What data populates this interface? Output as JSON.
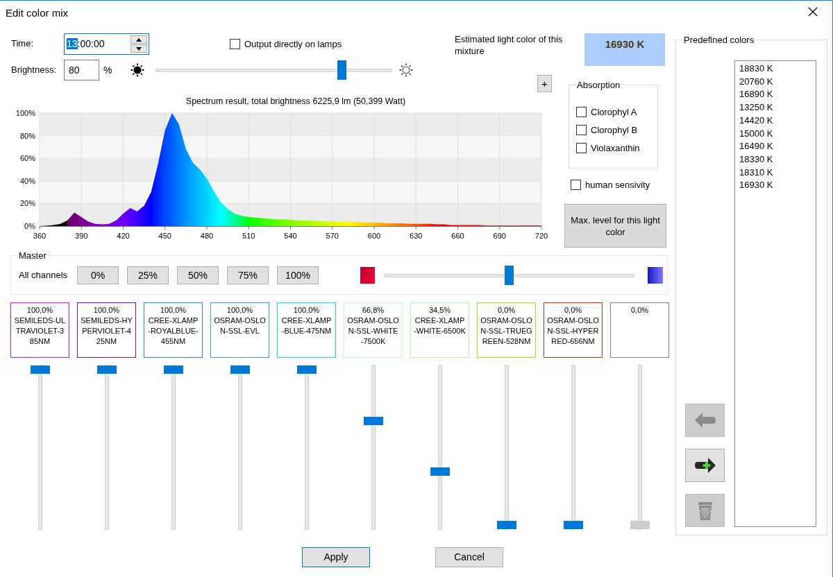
{
  "window": {
    "title": "Edit color mix"
  },
  "time": {
    "label": "Time:",
    "value_parts": [
      {
        "text": "13",
        "selected": true
      },
      {
        "text": ":00:00",
        "selected": false
      }
    ]
  },
  "output_directly": {
    "label": "Output directly on lamps",
    "checked": false
  },
  "brightness": {
    "label": "Brightness:",
    "value": "80",
    "unit": "%",
    "level": 0.8
  },
  "estimate": {
    "label": "Estimated light color of this mixture",
    "value": "16930 K"
  },
  "zoom_button": {
    "label": "+"
  },
  "spectrum": {
    "chart_data": {
      "type": "area",
      "title": "Spectrum result, total brightness 6225,9 lm (50,399 Watt)",
      "x": [
        360,
        365,
        370,
        375,
        380,
        385,
        390,
        395,
        400,
        405,
        410,
        415,
        420,
        425,
        430,
        435,
        440,
        445,
        450,
        455,
        460,
        465,
        470,
        475,
        480,
        485,
        490,
        495,
        500,
        505,
        510,
        515,
        520,
        525,
        530,
        535,
        540,
        545,
        550,
        555,
        560,
        565,
        570,
        575,
        580,
        585,
        590,
        595,
        600,
        605,
        610,
        615,
        620,
        625,
        630,
        635,
        640,
        645,
        650,
        655,
        660,
        665,
        670,
        675,
        680,
        685,
        690,
        695,
        700,
        705,
        710,
        715,
        720
      ],
      "values": [
        0,
        0.3,
        1,
        2,
        5,
        12,
        8,
        4,
        2,
        1.5,
        2,
        5,
        11,
        16,
        13,
        18,
        30,
        55,
        85,
        100,
        90,
        68,
        56,
        50,
        42,
        31,
        21,
        15,
        11,
        9,
        8,
        7.5,
        7,
        6.5,
        6,
        6,
        5.5,
        5,
        5,
        5,
        4.5,
        4.5,
        4,
        4,
        4,
        3.5,
        3.5,
        3,
        3,
        3,
        2.5,
        2.5,
        2.5,
        2,
        2,
        2,
        2,
        1.5,
        1.5,
        1,
        1,
        1,
        1,
        1,
        0.5,
        0.5,
        0.5,
        0.5,
        0.5,
        0.5,
        0.5,
        0.5,
        0.5
      ],
      "xlim": [
        360,
        720
      ],
      "ylim": [
        0,
        100
      ],
      "xticks": [
        360,
        390,
        420,
        450,
        480,
        510,
        540,
        570,
        600,
        630,
        660,
        690,
        720
      ],
      "yticks": [
        {
          "value": 0,
          "label": "0%"
        },
        {
          "value": 20,
          "label": "20%"
        },
        {
          "value": 40,
          "label": "40%"
        },
        {
          "value": 60,
          "label": "60%"
        },
        {
          "value": 80,
          "label": "80%"
        },
        {
          "value": 100,
          "label": "100%"
        }
      ],
      "grid": true
    }
  },
  "absorption": {
    "title": "Absorption",
    "items": [
      {
        "label": "Clorophyl A",
        "checked": false
      },
      {
        "label": "Clorophyl B",
        "checked": false
      },
      {
        "label": "Violaxanthin",
        "checked": false
      }
    ]
  },
  "human_sensitivity": {
    "label": "human sensivity",
    "checked": false
  },
  "max_level_button": {
    "label": "Max. level for this light color"
  },
  "master": {
    "title": "Master",
    "label": "All channels",
    "presets": [
      "0%",
      "25%",
      "50%",
      "75%",
      "100%"
    ],
    "level": 0.5
  },
  "channels": [
    {
      "level_text": "100,0%",
      "name": "SEMILEDS-ULTRAVIOLET-385NM",
      "color": "#ff00ff",
      "level": 1,
      "disabled": false
    },
    {
      "level_text": "100,0%",
      "name": "SEMILEDS-HYPERVIOLET-425NM",
      "color": "#7f00ff",
      "level": 1,
      "disabled": false
    },
    {
      "level_text": "100,0%",
      "name": "CREE-XLAMP-ROYALBLUE-455NM",
      "color": "#1e88ff",
      "level": 1,
      "disabled": false
    },
    {
      "level_text": "100,0%",
      "name": "OSRAM-OSLON-SSL-EVL",
      "color": "#3399ff",
      "level": 1,
      "disabled": false
    },
    {
      "level_text": "100,0%",
      "name": "CREE-XLAMP-BLUE-475NM",
      "color": "#00e1ff",
      "level": 1,
      "disabled": false
    },
    {
      "level_text": "66,8%",
      "name": "OSRAM-OSLON-SSL-WHITE-7500K",
      "color": "#c4ffc4",
      "level": 0.668,
      "disabled": false
    },
    {
      "level_text": "34,5%",
      "name": "CREE-XLAMP-WHITE-6500K",
      "color": "#b0ffb0",
      "level": 0.345,
      "disabled": false
    },
    {
      "level_text": "0,0%",
      "name": "OSRAM-OSLON-SSL-TRUEGREEN-528NM",
      "color": "#80ff00",
      "level": 0,
      "disabled": false
    },
    {
      "level_text": "0,0%",
      "name": "OSRAM-OSLON-SSL-HYPERRED-656NM",
      "color": "#ff2000",
      "level": 0,
      "disabled": false
    },
    {
      "level_text": "0,0%",
      "color": "#808080",
      "level": 0,
      "disabled": true
    }
  ],
  "predefined": {
    "title": "Predefined colors",
    "items": [
      {
        "label": "18830 K",
        "selected": false
      },
      {
        "label": "20760 K",
        "selected": false
      },
      {
        "label": "16890 K",
        "selected": false
      },
      {
        "label": "13250 K",
        "selected": false
      },
      {
        "label": "14420 K",
        "selected": false
      },
      {
        "label": "15000 K",
        "selected": false
      },
      {
        "label": "16490 K",
        "selected": false
      },
      {
        "label": "18330 K",
        "selected": false
      },
      {
        "label": "18310 K",
        "selected": false
      },
      {
        "label": "16930 K",
        "selected": false
      }
    ],
    "actions": [
      {
        "kind": "remove",
        "disabled": true
      },
      {
        "kind": "add",
        "disabled": false
      },
      {
        "kind": "delete",
        "disabled": true
      }
    ]
  },
  "buttons": [
    {
      "label": "Apply",
      "default": true
    },
    {
      "label": "Cancel",
      "default": false
    }
  ]
}
